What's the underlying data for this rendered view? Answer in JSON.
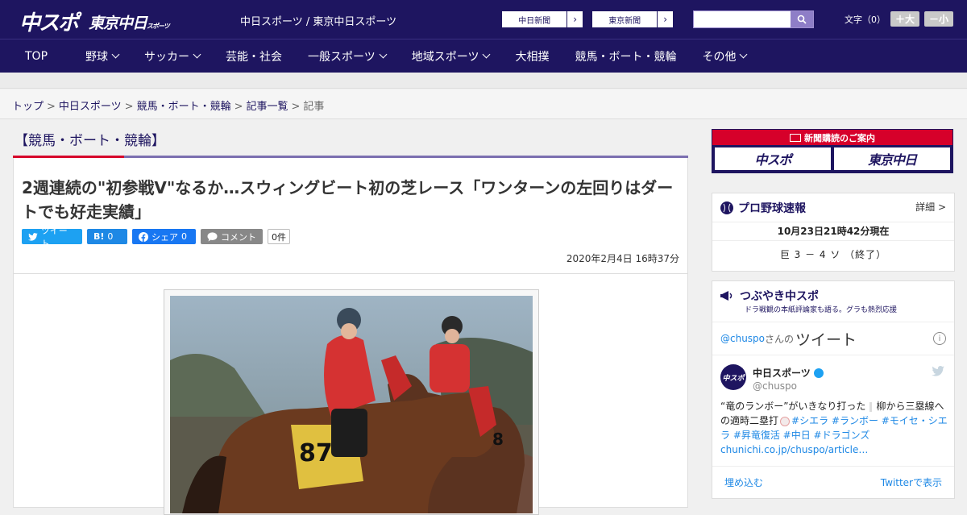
{
  "header": {
    "logo_main": "中スポ",
    "logo_sub": "東京中日",
    "logo_sub_small": "スポーツ",
    "site_links": "中日スポーツ / 東京中日スポーツ",
    "paper1": "中日新聞",
    "paper2": "東京新聞",
    "font_label": "文字（0）",
    "font_plus": "＋大",
    "font_minus": "－小",
    "arrow": "›"
  },
  "nav": [
    {
      "label": "TOP",
      "dropdown": false
    },
    {
      "label": "野球",
      "dropdown": true
    },
    {
      "label": "サッカー",
      "dropdown": true
    },
    {
      "label": "芸能・社会",
      "dropdown": false
    },
    {
      "label": "一般スポーツ",
      "dropdown": true
    },
    {
      "label": "地域スポーツ",
      "dropdown": true
    },
    {
      "label": "大相撲",
      "dropdown": false
    },
    {
      "label": "競馬・ボート・競輪",
      "dropdown": false
    },
    {
      "label": "その他",
      "dropdown": true
    }
  ],
  "breadcrumb": {
    "items": [
      "トップ",
      "中日スポーツ",
      "競馬・ボート・競輪",
      "記事一覧"
    ],
    "current": "記事",
    "sep": ">"
  },
  "article": {
    "category": "【競馬・ボート・競輪】",
    "headline": "2週連続の\"初参戦V\"なるか…スウィングビート初の芝レース「ワンターンの左回りはダートでも好走実績」",
    "share": {
      "twitter": "ツイート",
      "hatena": "B!",
      "hatena_count": "0",
      "facebook": "シェア",
      "facebook_count": "0",
      "comment": "コメント",
      "comment_count": "0件"
    },
    "date": "2020年2月4日 16時37分",
    "photo_number": "87",
    "photo_number_partial": "8"
  },
  "sidebar": {
    "subscribe_header": "新聞購読のご案内",
    "sub_paper1": "中スポ",
    "sub_paper2": "東京中日",
    "baseball": {
      "title": "プロ野球速報",
      "more": "詳細 >",
      "timestamp": "10月23日21時42分現在",
      "score": "巨 3 － 4 ソ （終了）"
    },
    "tsubuyaki": {
      "title": "つぶやき中スポ",
      "subtitle": "ドラ戦観の本紙評論家も語る。グラも熱烈応援",
      "handle_prefix": "@chuspo",
      "handle_suffix": "さんの",
      "tweets_label": "ツイート",
      "user_name": "中日スポーツ",
      "user_handle": "@chuspo",
      "avatar_text": "中スポ",
      "text_prefix": "“竜のランボー”がいきなり打った",
      "text_mid": "柳から三塁線への適時二塁打",
      "hashtags": "#シエラ #ランボー #モイセ・シエラ #昇竜復活 #中日 #ドラゴンズ",
      "link": "chunichi.co.jp/chuspo/article…",
      "embed": "埋め込む",
      "view_on": "Twitterで表示"
    }
  },
  "colors": {
    "brand": "#1e1560",
    "accent_red": "#d6002a",
    "link_blue": "#1e88e5"
  }
}
